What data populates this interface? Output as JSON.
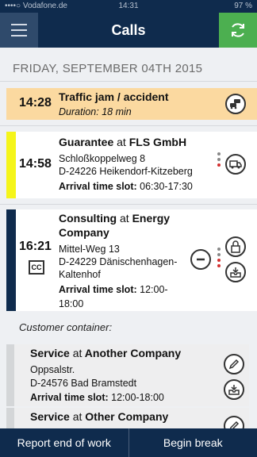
{
  "status_bar": {
    "carrier": "••••○ Vodafone.de",
    "time": "14:31",
    "battery": "97 %"
  },
  "header": {
    "title": "Calls"
  },
  "date_header": "FRIDAY, SEPTEMBER 04TH 2015",
  "calls": [
    {
      "time": "14:28",
      "type": "Traffic jam / accident",
      "duration": "Duration: 18 min",
      "highlight_color": "#fbd9a0"
    },
    {
      "time": "14:58",
      "type": "Guarantee",
      "at": "at",
      "company": "FLS GmbH",
      "street": "Schloßkoppelweg 8",
      "city": "D-24226 Heikendorf-Kitzeberg",
      "slot_label": "Arrival time slot:",
      "slot_value": "06:30-17:30",
      "stripe_color": "#f5f51a"
    },
    {
      "time": "16:21",
      "type": "Consulting",
      "at": "at",
      "company": "Energy",
      "company_line2": "Company",
      "street": "Mittel-Weg 13",
      "city_line1": "D-24229 Dänischenhagen-",
      "city_line2": "Kaltenhof",
      "slot_label": "Arrival time slot:",
      "slot_value_line1": "12:00-",
      "slot_value_line2": "18:00",
      "stripe_color": "#0f2b4d"
    }
  ],
  "container_label": "Customer container:",
  "container_items": [
    {
      "type": "Service",
      "at": "at",
      "company": "Another Company",
      "street": "Oppsalstr.",
      "city": "D-24576 Bad Bramstedt",
      "slot_label": "Arrival time slot:",
      "slot_value": "12:00-18:00"
    },
    {
      "type": "Service",
      "at": "at",
      "company": "Other Company"
    }
  ],
  "bottom_bar": {
    "report": "Report end of work",
    "break": "Begin break"
  },
  "colors": {
    "navy": "#0f2b4d",
    "green": "#4caf50",
    "orange": "#fbd9a0",
    "yellow": "#f5f51a"
  }
}
